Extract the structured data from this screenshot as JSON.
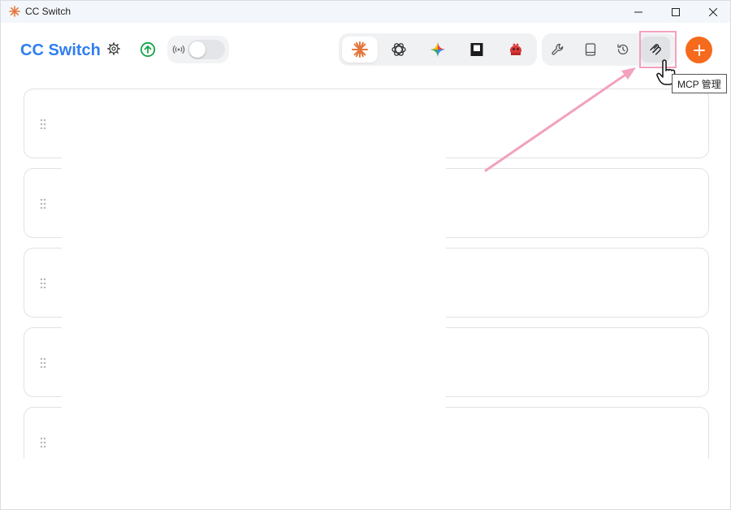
{
  "window": {
    "title": "CC Switch"
  },
  "header": {
    "app_title": "CC Switch",
    "proxy_enabled": false
  },
  "app_switcher": {
    "tabs": [
      {
        "name": "claude-icon",
        "active": true
      },
      {
        "name": "openai-icon",
        "active": false
      },
      {
        "name": "gemini-icon",
        "active": false
      },
      {
        "name": "app-square-icon",
        "active": false
      },
      {
        "name": "mascot-icon",
        "active": false
      }
    ]
  },
  "tools": {
    "items": [
      {
        "name": "wrench-icon"
      },
      {
        "name": "book-icon"
      },
      {
        "name": "history-icon"
      },
      {
        "name": "mcp-icon"
      }
    ],
    "hovered": "mcp-icon"
  },
  "tooltip": {
    "text": "MCP 管理"
  },
  "annotation": {
    "color": "#f2a1bf"
  },
  "colors": {
    "accent": "#2f7ef0",
    "add_button": "#f56a1d",
    "update_green": "#16a34a"
  },
  "provider_cards": [
    {
      "index": 1
    },
    {
      "index": 2
    },
    {
      "index": 3
    },
    {
      "index": 4
    },
    {
      "index": 5
    }
  ]
}
